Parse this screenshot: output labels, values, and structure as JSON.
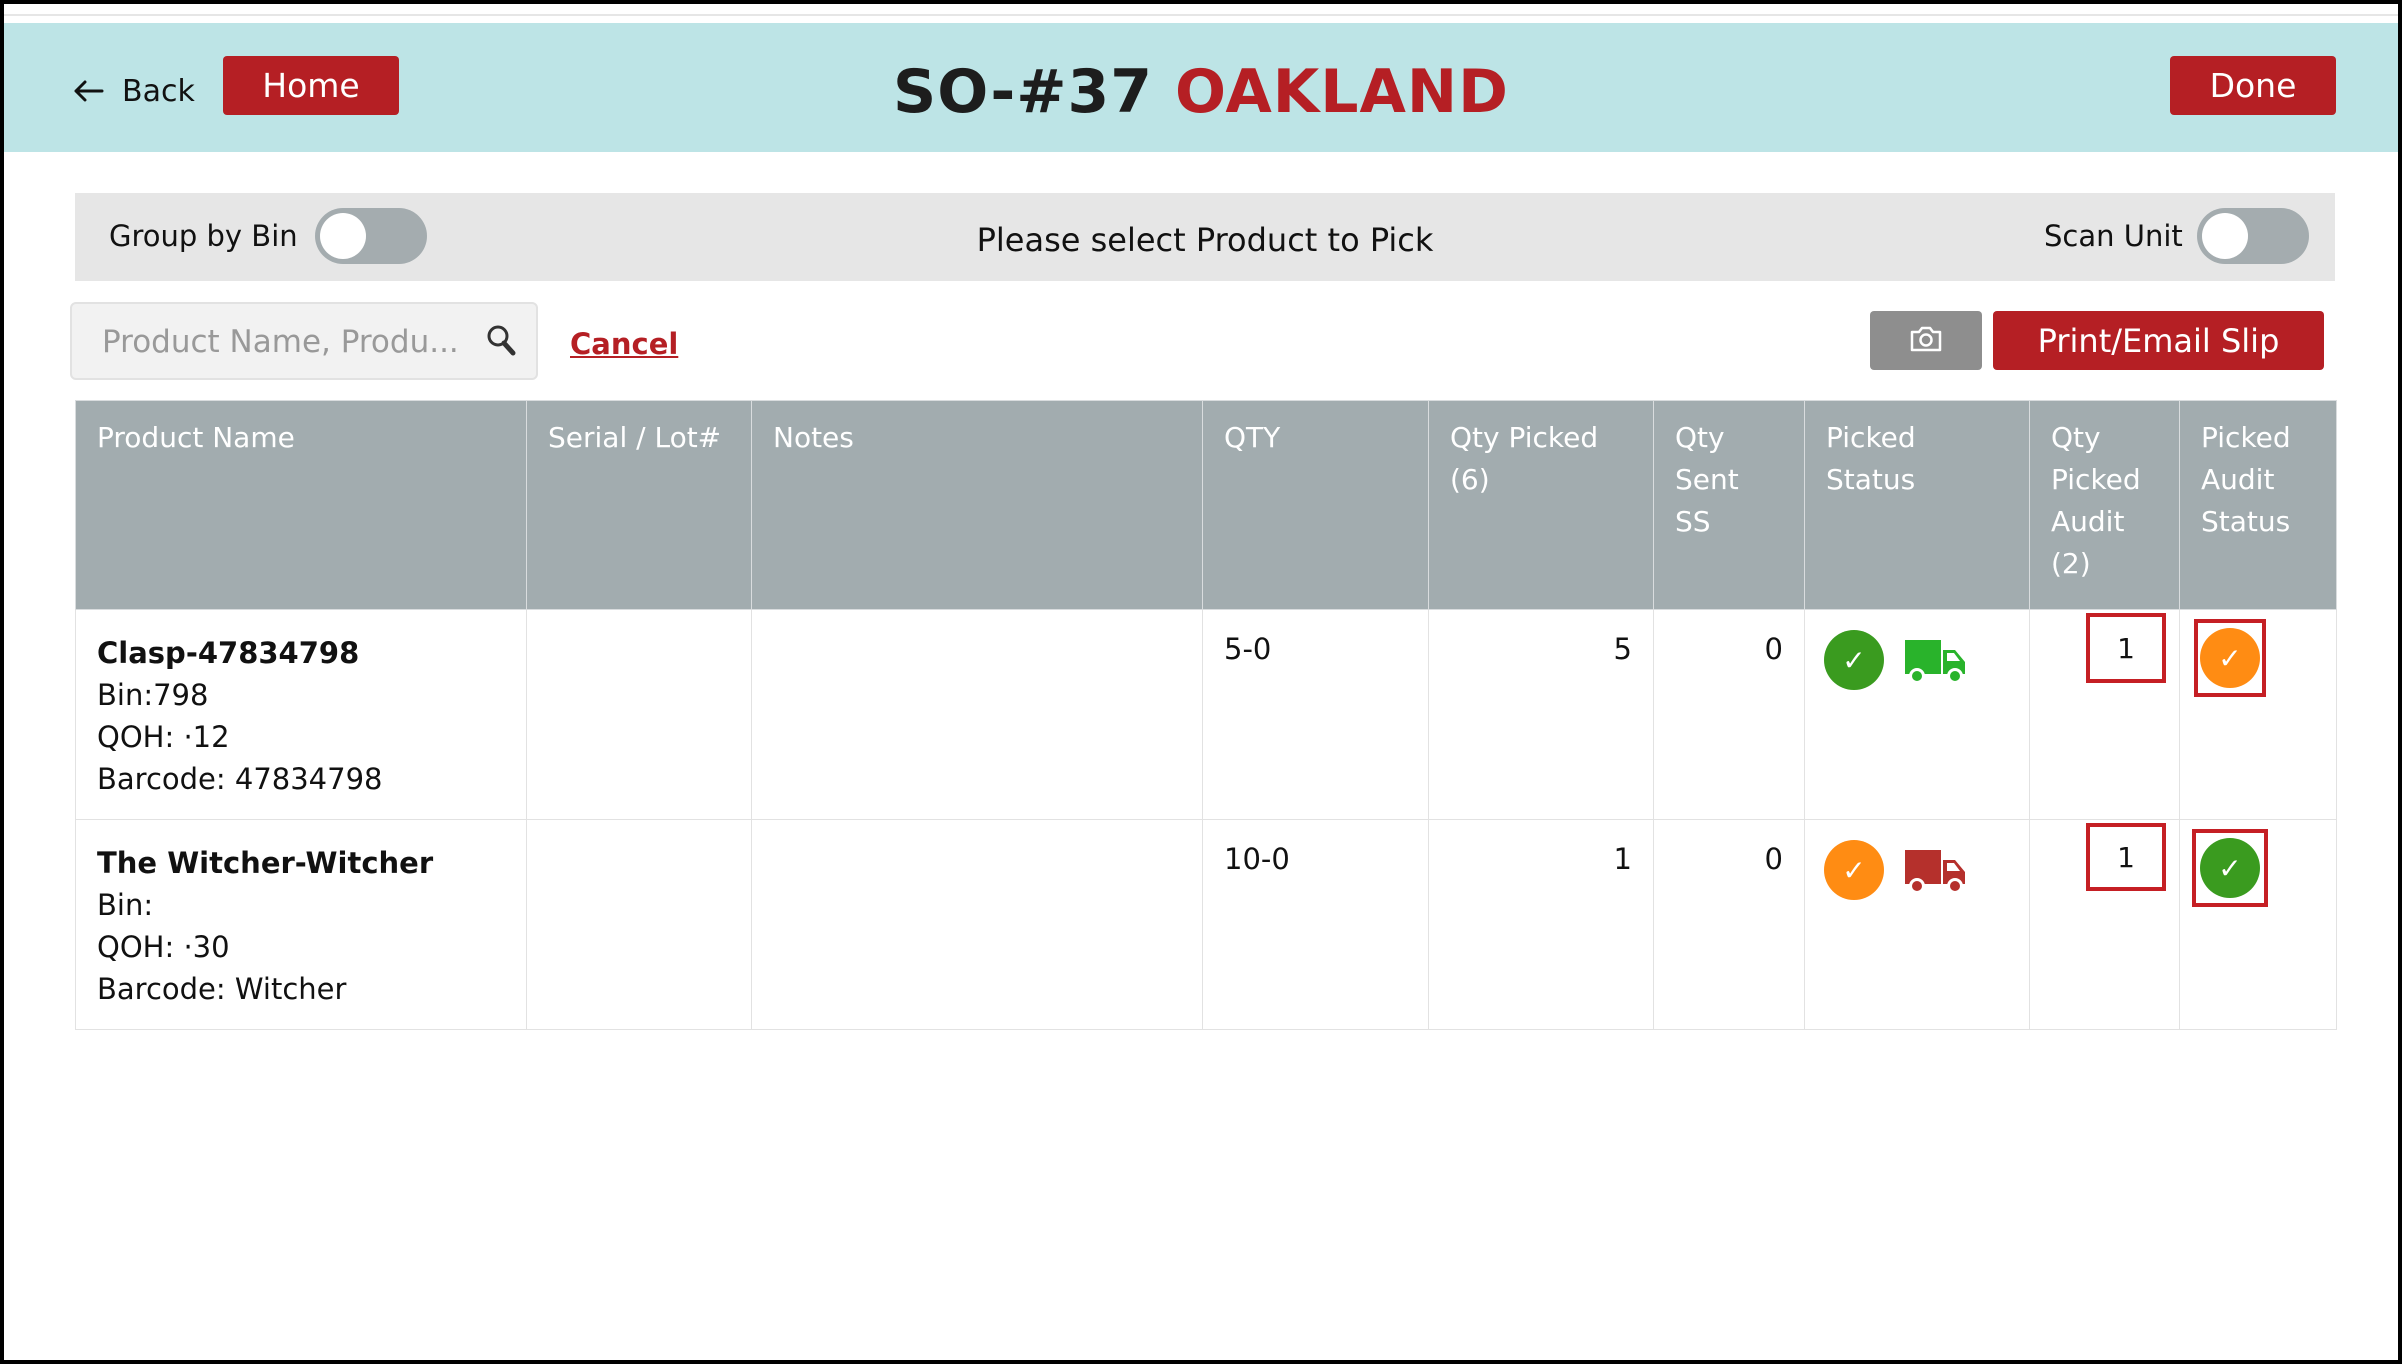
{
  "header": {
    "back_label": "Back",
    "home_label": "Home",
    "title_order": "SO-#37",
    "title_location": "OAKLAND",
    "done_label": "Done",
    "background_color": "#bde4e6",
    "accent_color": "#b51f24"
  },
  "toolbar": {
    "group_by_bin_label": "Group by Bin",
    "group_by_bin_on": false,
    "prompt": "Please select Product to Pick",
    "scan_unit_label": "Scan Unit",
    "scan_unit_on": false
  },
  "search": {
    "placeholder": "Product Name, Produ...",
    "value": "",
    "icon": "search-icon",
    "cancel_label": "Cancel"
  },
  "actions": {
    "camera_icon": "camera-icon",
    "print_label": "Print/Email Slip"
  },
  "table": {
    "columns": [
      {
        "line1": "Product Name",
        "line2": "",
        "line3": "",
        "line4": ""
      },
      {
        "line1": "Serial / Lot#",
        "line2": "",
        "line3": "",
        "line4": ""
      },
      {
        "line1": "Notes",
        "line2": "",
        "line3": "",
        "line4": ""
      },
      {
        "line1": "QTY",
        "line2": "",
        "line3": "",
        "line4": ""
      },
      {
        "line1": "Qty Picked",
        "line2": "(6)",
        "line3": "",
        "line4": ""
      },
      {
        "line1": "Qty",
        "line2": "Sent SS",
        "line3": "",
        "line4": ""
      },
      {
        "line1": "Picked",
        "line2": "Status",
        "line3": "",
        "line4": ""
      },
      {
        "line1": "Qty",
        "line2": "Picked",
        "line3": "Audit",
        "line4": "(2)"
      },
      {
        "line1": "Picked",
        "line2": "Audit",
        "line3": "Status",
        "line4": ""
      }
    ],
    "rows": [
      {
        "product_name": "Clasp-47834798",
        "bin": "Bin:798",
        "qoh": "QOH:  ·12",
        "barcode": "Barcode: 47834798",
        "serial": "",
        "notes": "",
        "qty": "5-0",
        "qty_picked": "5",
        "qty_sent_ss": "0",
        "picked_status_color": "#3a9b1f",
        "truck_color": "#29b32b",
        "qty_picked_audit": "1",
        "audit_status_color": "#ff8c13"
      },
      {
        "product_name": "The Witcher-Witcher",
        "bin": "Bin:",
        "qoh": "QOH:  ·30",
        "barcode": "Barcode: Witcher",
        "serial": "",
        "notes": "",
        "qty": "10-0",
        "qty_picked": "1",
        "qty_sent_ss": "0",
        "picked_status_color": "#ff8c13",
        "truck_color": "#b5302c",
        "qty_picked_audit": "1",
        "audit_status_color": "#3a9b1f"
      }
    ]
  },
  "check_glyph": "✓"
}
